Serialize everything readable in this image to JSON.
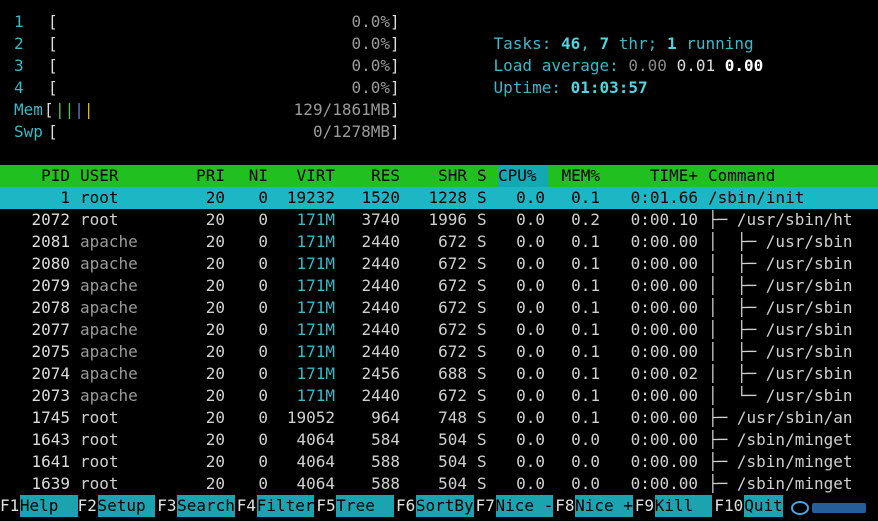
{
  "meters": {
    "cpus": [
      {
        "id": "1",
        "value": "0.0%"
      },
      {
        "id": "2",
        "value": "0.0%"
      },
      {
        "id": "3",
        "value": "0.0%"
      },
      {
        "id": "4",
        "value": "0.0%"
      }
    ],
    "mem": {
      "label": "Mem",
      "bar_open": "[",
      "bar_close": "]",
      "value": "129/1861MB"
    },
    "swp": {
      "label": "Swp",
      "bar_open": "[",
      "bar_close": "]",
      "value": "0/1278MB"
    }
  },
  "summary": {
    "tasks_label": "Tasks:",
    "tasks": "46",
    "threads": "7",
    "thr_label": "thr;",
    "running": "1",
    "running_label": "running",
    "load_label": "Load average:",
    "load1": "0.00",
    "load5": "0.01",
    "load15": "0.00",
    "uptime_label": "Uptime:",
    "uptime": "01:03:57"
  },
  "table": {
    "columns": [
      "PID",
      "USER",
      "PRI",
      "NI",
      "VIRT",
      "RES",
      "SHR",
      "S",
      "CPU%",
      "MEM%",
      "TIME+",
      "Command"
    ],
    "rows": [
      {
        "pid": "1",
        "user": "root",
        "pri": "20",
        "ni": "0",
        "virt": "19232",
        "res": "1520",
        "shr": "1228",
        "s": "S",
        "cpu": "0.0",
        "mem": "0.1",
        "time": "0:01.66",
        "cmd": "/sbin/init"
      },
      {
        "pid": "2072",
        "user": "root",
        "pri": "20",
        "ni": "0",
        "virt": "171M",
        "res": "3740",
        "shr": "1996",
        "s": "S",
        "cpu": "0.0",
        "mem": "0.2",
        "time": "0:00.10",
        "cmd": "├─ /usr/sbin/ht"
      },
      {
        "pid": "2081",
        "user": "apache",
        "pri": "20",
        "ni": "0",
        "virt": "171M",
        "res": "2440",
        "shr": "672",
        "s": "S",
        "cpu": "0.0",
        "mem": "0.1",
        "time": "0:00.00",
        "cmd": "│  ├─ /usr/sbin"
      },
      {
        "pid": "2080",
        "user": "apache",
        "pri": "20",
        "ni": "0",
        "virt": "171M",
        "res": "2440",
        "shr": "672",
        "s": "S",
        "cpu": "0.0",
        "mem": "0.1",
        "time": "0:00.00",
        "cmd": "│  ├─ /usr/sbin"
      },
      {
        "pid": "2079",
        "user": "apache",
        "pri": "20",
        "ni": "0",
        "virt": "171M",
        "res": "2440",
        "shr": "672",
        "s": "S",
        "cpu": "0.0",
        "mem": "0.1",
        "time": "0:00.00",
        "cmd": "│  ├─ /usr/sbin"
      },
      {
        "pid": "2078",
        "user": "apache",
        "pri": "20",
        "ni": "0",
        "virt": "171M",
        "res": "2440",
        "shr": "672",
        "s": "S",
        "cpu": "0.0",
        "mem": "0.1",
        "time": "0:00.00",
        "cmd": "│  ├─ /usr/sbin"
      },
      {
        "pid": "2077",
        "user": "apache",
        "pri": "20",
        "ni": "0",
        "virt": "171M",
        "res": "2440",
        "shr": "672",
        "s": "S",
        "cpu": "0.0",
        "mem": "0.1",
        "time": "0:00.00",
        "cmd": "│  ├─ /usr/sbin"
      },
      {
        "pid": "2075",
        "user": "apache",
        "pri": "20",
        "ni": "0",
        "virt": "171M",
        "res": "2440",
        "shr": "672",
        "s": "S",
        "cpu": "0.0",
        "mem": "0.1",
        "time": "0:00.00",
        "cmd": "│  ├─ /usr/sbin"
      },
      {
        "pid": "2074",
        "user": "apache",
        "pri": "20",
        "ni": "0",
        "virt": "171M",
        "res": "2456",
        "shr": "688",
        "s": "S",
        "cpu": "0.0",
        "mem": "0.1",
        "time": "0:00.02",
        "cmd": "│  ├─ /usr/sbin"
      },
      {
        "pid": "2073",
        "user": "apache",
        "pri": "20",
        "ni": "0",
        "virt": "171M",
        "res": "2440",
        "shr": "672",
        "s": "S",
        "cpu": "0.0",
        "mem": "0.1",
        "time": "0:00.00",
        "cmd": "│  └─ /usr/sbin"
      },
      {
        "pid": "1745",
        "user": "root",
        "pri": "20",
        "ni": "0",
        "virt": "19052",
        "res": "964",
        "shr": "748",
        "s": "S",
        "cpu": "0.0",
        "mem": "0.1",
        "time": "0:00.00",
        "cmd": "├─ /usr/sbin/an"
      },
      {
        "pid": "1643",
        "user": "root",
        "pri": "20",
        "ni": "0",
        "virt": "4064",
        "res": "584",
        "shr": "504",
        "s": "S",
        "cpu": "0.0",
        "mem": "0.0",
        "time": "0:00.00",
        "cmd": "├─ /sbin/minget"
      },
      {
        "pid": "1641",
        "user": "root",
        "pri": "20",
        "ni": "0",
        "virt": "4064",
        "res": "588",
        "shr": "504",
        "s": "S",
        "cpu": "0.0",
        "mem": "0.0",
        "time": "0:00.00",
        "cmd": "├─ /sbin/minget"
      },
      {
        "pid": "1639",
        "user": "root",
        "pri": "20",
        "ni": "0",
        "virt": "4064",
        "res": "588",
        "shr": "504",
        "s": "S",
        "cpu": "0.0",
        "mem": "0.0",
        "time": "0:00.00",
        "cmd": "├─ /sbin/minget"
      }
    ]
  },
  "footer": [
    {
      "key": "F1",
      "label": "Help  "
    },
    {
      "key": "F2",
      "label": "Setup "
    },
    {
      "key": "F3",
      "label": "Search"
    },
    {
      "key": "F4",
      "label": "Filter"
    },
    {
      "key": "F5",
      "label": "Tree  "
    },
    {
      "key": "F6",
      "label": "SortBy"
    },
    {
      "key": "F7",
      "label": "Nice -"
    },
    {
      "key": "F8",
      "label": "Nice +"
    },
    {
      "key": "F9",
      "label": "Kill  "
    },
    {
      "key": "F10",
      "label": "Quit"
    }
  ],
  "colors": {
    "header_bg": "#1fc01f",
    "selected_bg": "#1cb6c4",
    "label": "#3ab9c8",
    "sort_col": "#12a8b4"
  }
}
